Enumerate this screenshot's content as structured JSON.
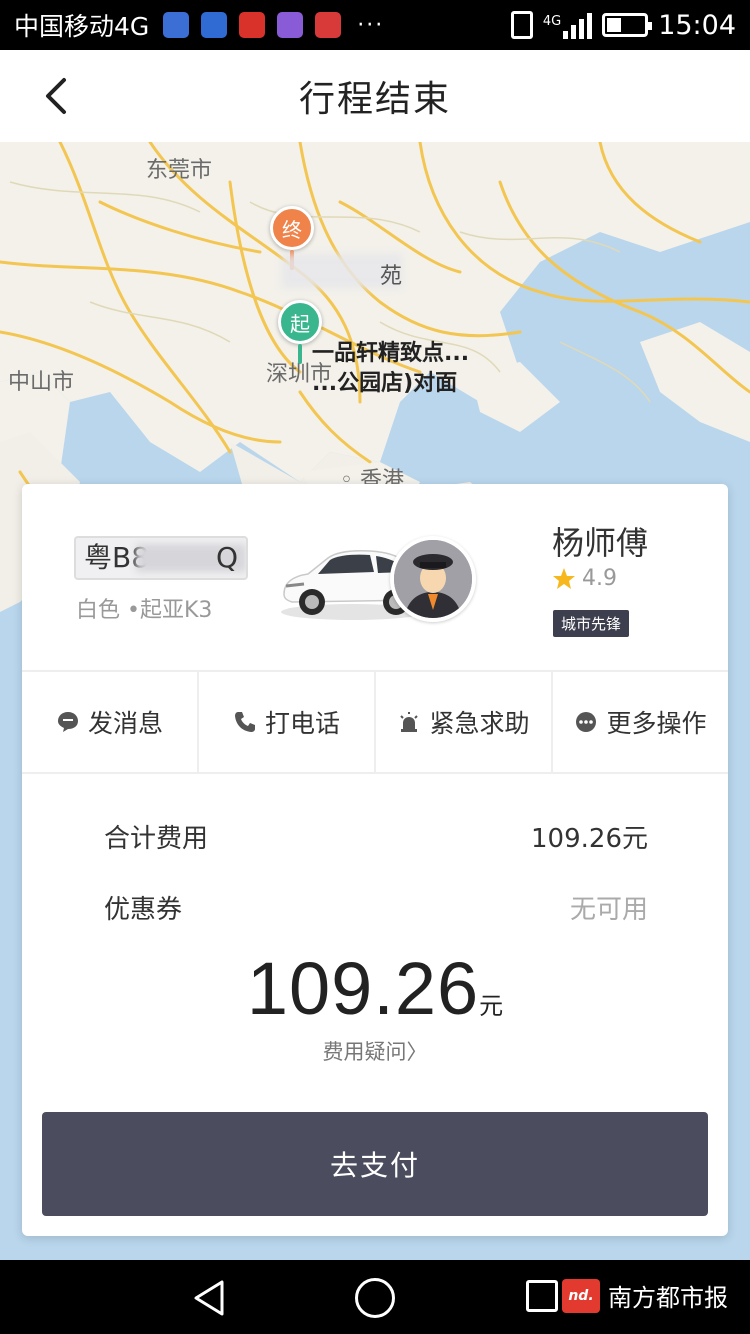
{
  "status_bar": {
    "carrier": "中国移动4G",
    "network": "4G",
    "time": "15:04",
    "more": "···",
    "app_icon_colors": [
      "#3b6fd6",
      "#2f6bd2",
      "#d9322b",
      "#8a5bd6",
      "#d83a3a"
    ]
  },
  "header": {
    "title": "行程结束",
    "back_icon": "chevron-left-icon"
  },
  "map": {
    "city_labels": {
      "dongguan": "东莞市",
      "zhongshan": "中山市",
      "shenzhen": "深圳市",
      "hongkong": "香港"
    },
    "end_pin": "终",
    "start_pin": "起",
    "end_label_partial": "苑",
    "start_label_line1": "一品轩精致点...",
    "start_label_line2": "...公园店)对面",
    "colors": {
      "end_pin": "#f0834a",
      "start_pin": "#39b68d",
      "water": "#b9d6ec",
      "land": "#f3f1ea",
      "road": "#f5c95c"
    }
  },
  "driver": {
    "plate": "粤B8",
    "plate_tail": "Q",
    "car_desc": "白色 •起亚K3",
    "name": "杨师傅",
    "rating": "4.9",
    "badge": "城市先锋"
  },
  "actions": [
    {
      "label": "发消息",
      "icon": "message-icon"
    },
    {
      "label": "打电话",
      "icon": "phone-icon"
    },
    {
      "label": "紧急求助",
      "icon": "alarm-icon"
    },
    {
      "label": "更多操作",
      "icon": "more-icon"
    }
  ],
  "fees": {
    "total_label": "合计费用",
    "total_value": "109.26元",
    "coupon_label": "优惠券",
    "coupon_value": "无可用",
    "amount": "109.26",
    "unit": "元",
    "dispute": "费用疑问〉"
  },
  "pay_button": "去支付",
  "watermark": {
    "logo": "nd.",
    "text": "南方都市报"
  }
}
